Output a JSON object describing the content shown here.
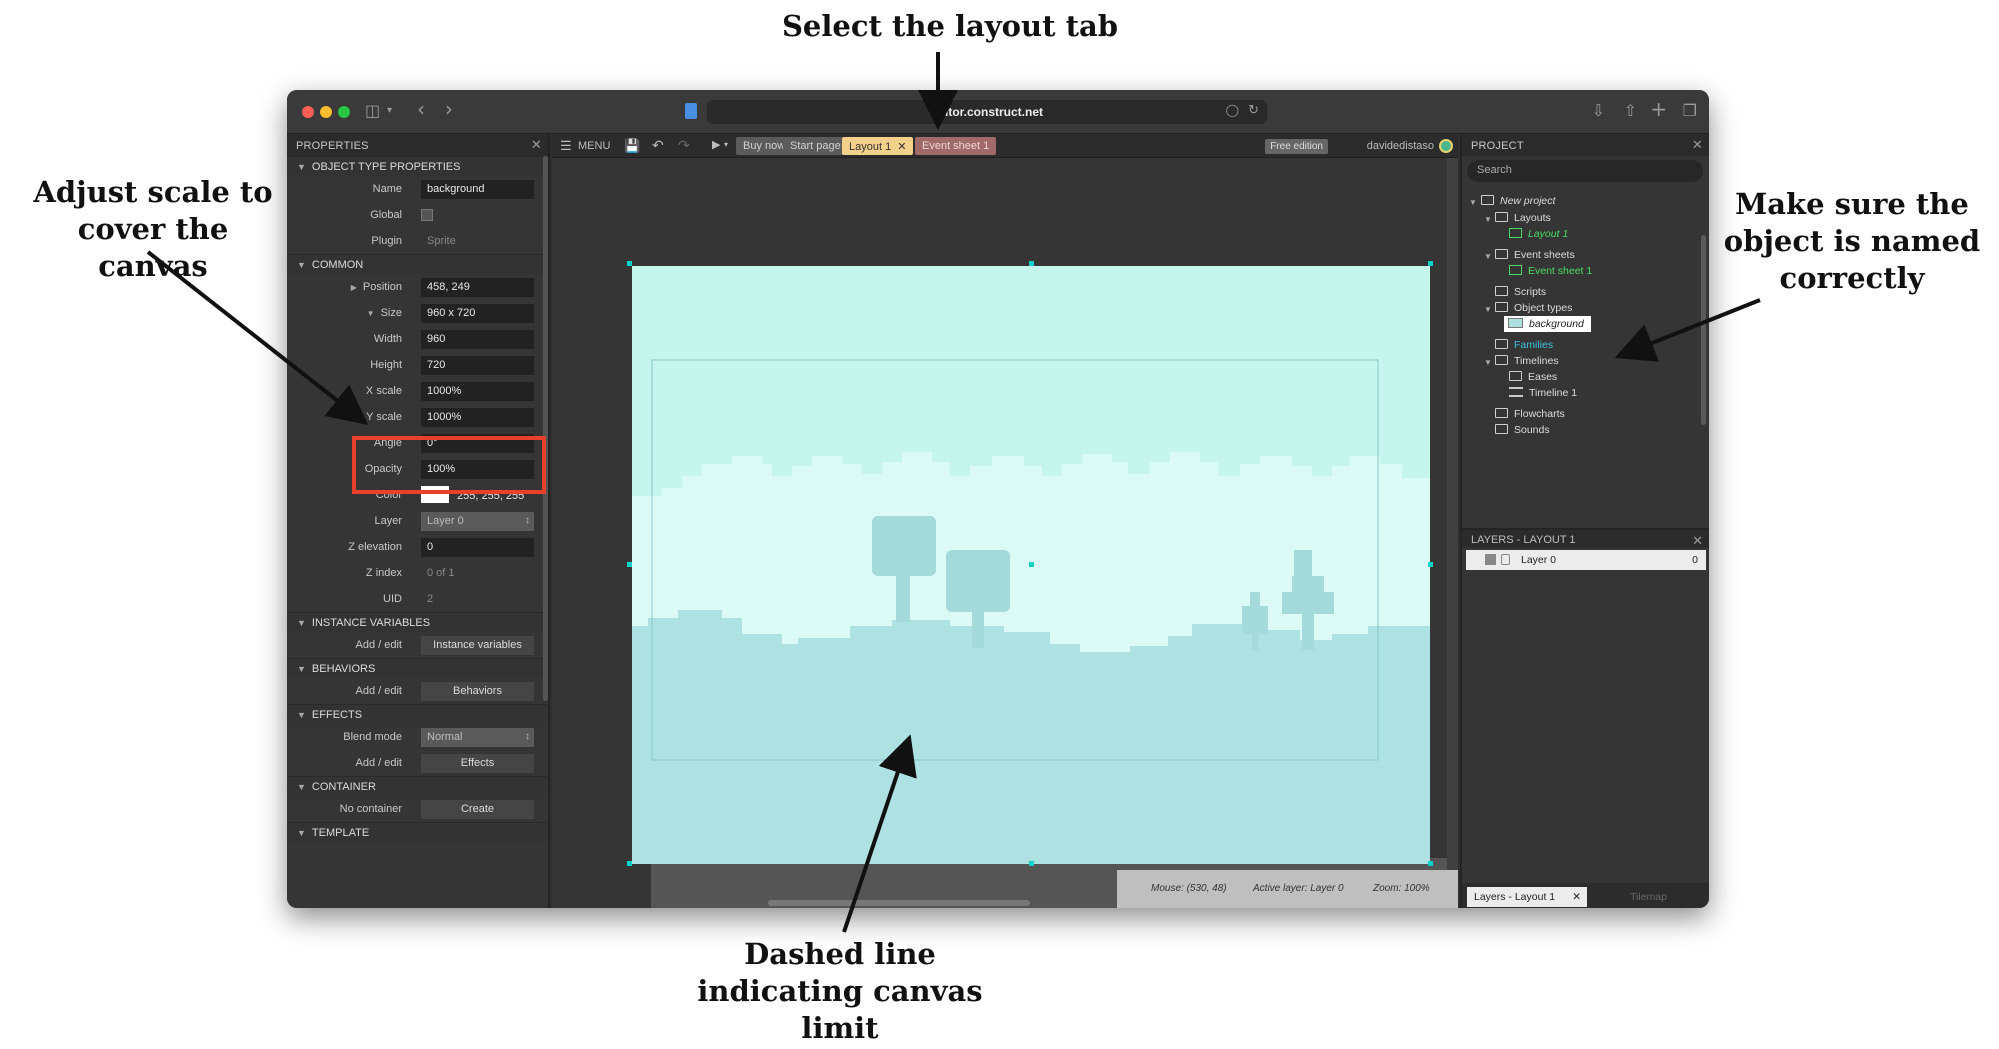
{
  "annotations": {
    "top": "Select the layout tab",
    "left": [
      "Adjust scale to",
      "cover the canvas"
    ],
    "right": [
      "Make sure the",
      "object is named",
      "correctly"
    ],
    "bottom": [
      "Dashed line",
      "indicating canvas",
      "limit"
    ]
  },
  "browser": {
    "url": "editor.construct.net",
    "nav_back": "‹",
    "nav_forward": "›"
  },
  "properties": {
    "title": "Properties",
    "sections": {
      "object_type": "Object type properties",
      "common": "Common",
      "instance_variables": "Instance variables",
      "behaviors": "Behaviors",
      "effects": "Effects",
      "container": "Container",
      "template": "Template"
    },
    "fields": {
      "name_label": "Name",
      "name_value": "background",
      "global_label": "Global",
      "plugin_label": "Plugin",
      "plugin_value": "Sprite",
      "position_label": "Position",
      "position_value": "458, 249",
      "size_label": "Size",
      "size_value": "960 x 720",
      "width_label": "Width",
      "width_value": "960",
      "height_label": "Height",
      "height_value": "720",
      "xscale_label": "X scale",
      "xscale_value": "1000%",
      "yscale_label": "Y scale",
      "yscale_value": "1000%",
      "angle_label": "Angle",
      "angle_value": "0°",
      "opacity_label": "Opacity",
      "opacity_value": "100%",
      "color_label": "Color",
      "color_value": "255, 255, 255",
      "layer_label": "Layer",
      "layer_value": "Layer 0",
      "zelev_label": "Z elevation",
      "zelev_value": "0",
      "zindex_label": "Z index",
      "zindex_value": "0 of 1",
      "uid_label": "UID",
      "uid_value": "2",
      "ivars_label": "Add / edit",
      "ivars_button": "Instance variables",
      "behaviors_label": "Add / edit",
      "behaviors_button": "Behaviors",
      "blend_label": "Blend mode",
      "blend_value": "Normal",
      "effects_label": "Add / edit",
      "effects_button": "Effects",
      "container_label": "No container",
      "container_button": "Create"
    }
  },
  "editor": {
    "menu": "MENU",
    "tabs": {
      "buy_now": "Buy now",
      "start_page": "Start page",
      "layout1": "Layout 1",
      "event_sheet1": "Event sheet 1"
    },
    "free_edition": "Free edition",
    "username": "davidedistaso",
    "status": {
      "mouse": "Mouse: (530, 48)",
      "active_layer": "Active layer: Layer 0",
      "zoom": "Zoom: 100%"
    },
    "scene_colors": {
      "sky": "#c6f5ee",
      "clouds": "#dcfaf5",
      "ground": "#aee2e2",
      "trees": "#a5dadb"
    }
  },
  "project": {
    "title": "Project",
    "search_placeholder": "Search",
    "tree": {
      "root": "New project",
      "layouts": "Layouts",
      "layout1": "Layout 1",
      "event_sheets": "Event sheets",
      "event_sheet1": "Event sheet 1",
      "scripts": "Scripts",
      "object_types": "Object types",
      "background": "background",
      "families": "Families",
      "timelines": "Timelines",
      "eases": "Eases",
      "timeline1": "Timeline 1",
      "flowcharts": "Flowcharts",
      "sounds": "Sounds"
    },
    "layers_title": "Layers - Layout 1",
    "layer_name": "Layer 0",
    "layer_number": "0",
    "bottom_tab_active": "Layers - Layout 1",
    "bottom_tab_other": "Tilemap"
  }
}
